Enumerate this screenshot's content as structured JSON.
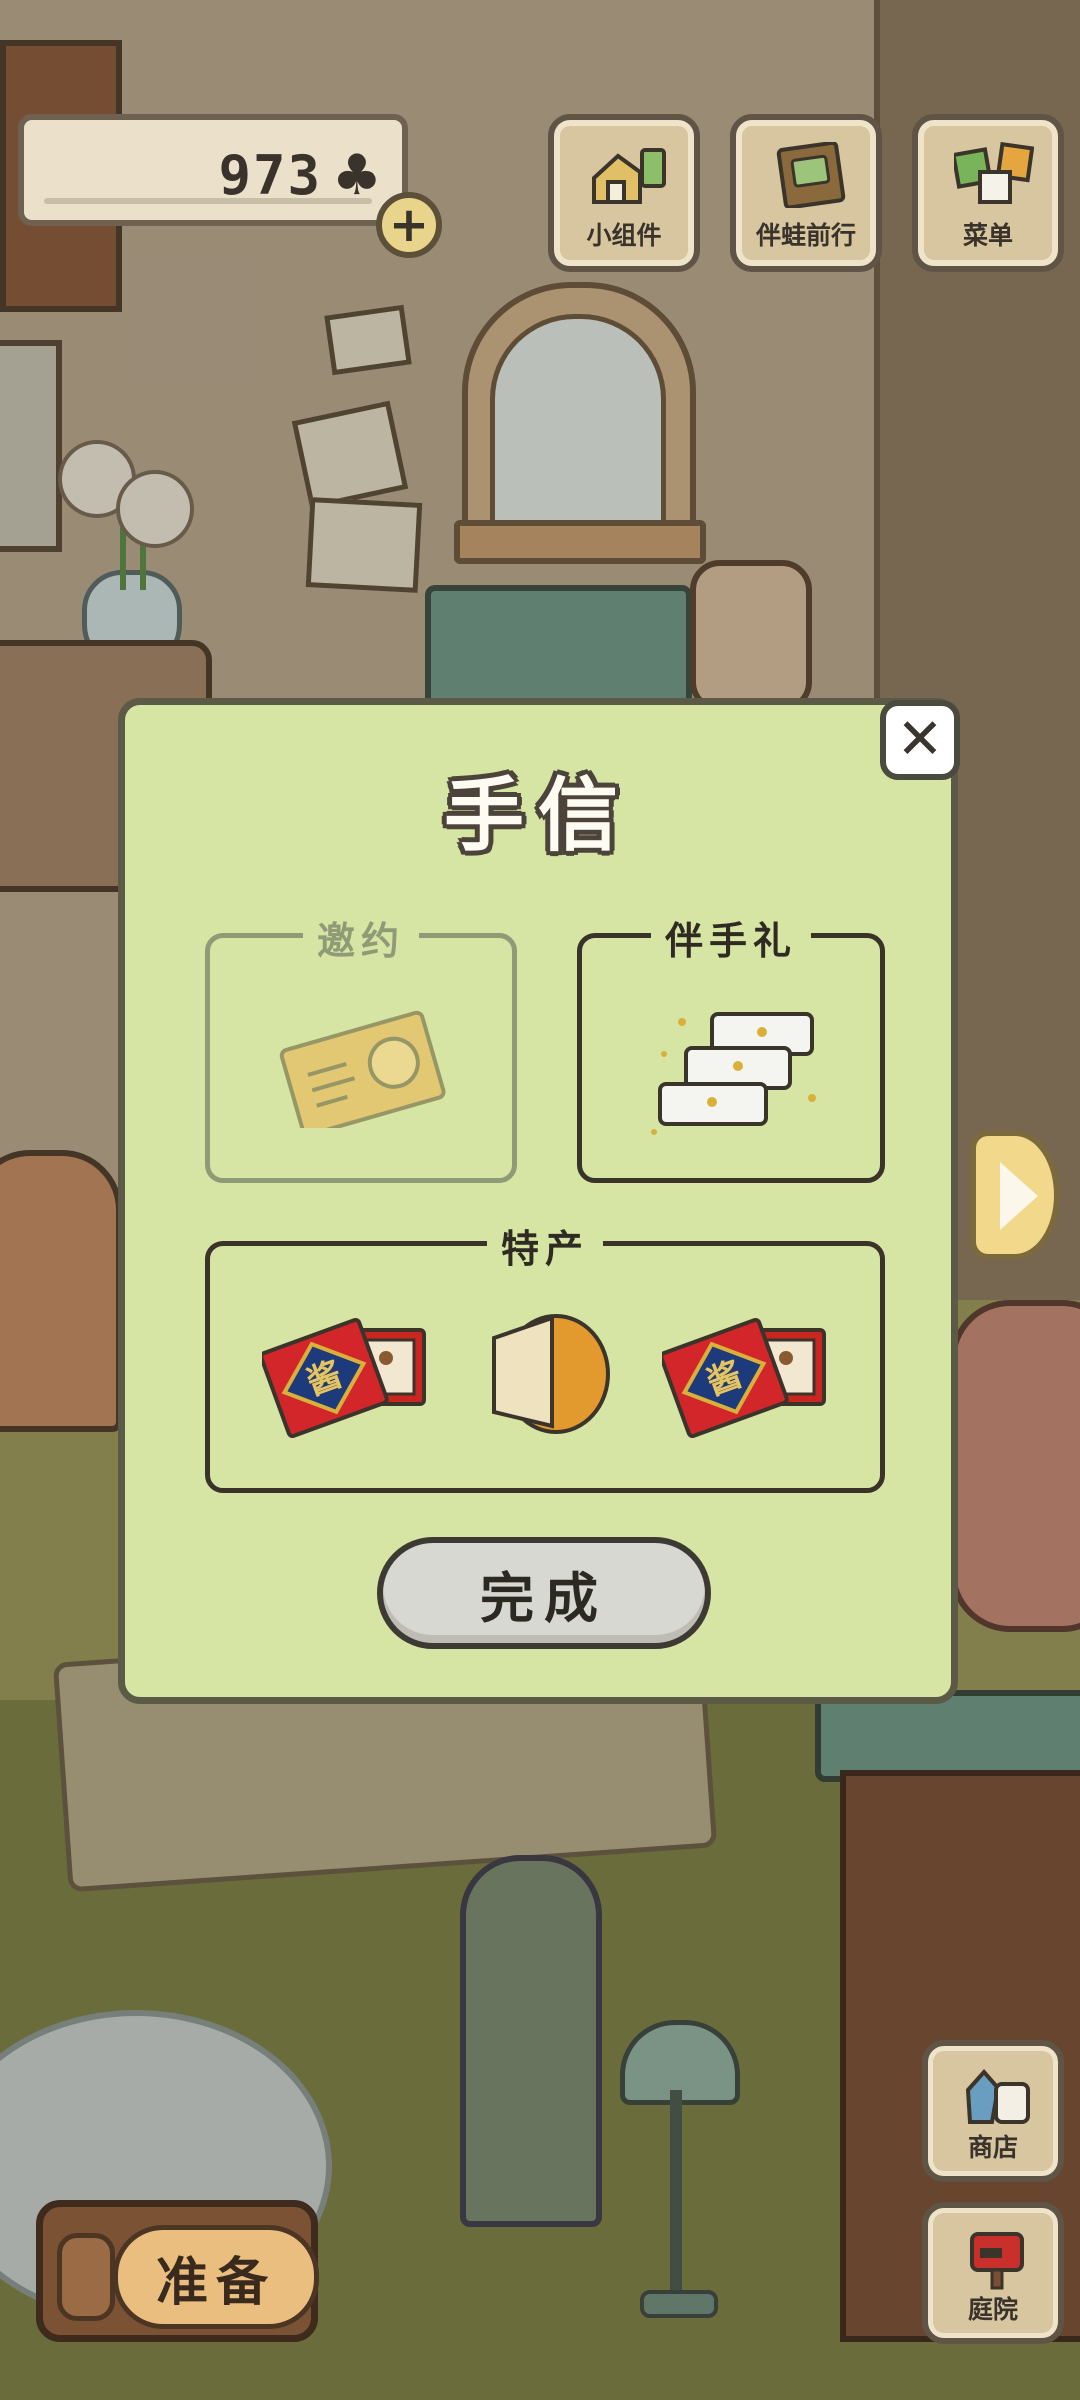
{
  "hud": {
    "clover_count": "973",
    "clover_symbol": "♣",
    "add_symbol": "+"
  },
  "top_buttons": [
    {
      "label": "小组件",
      "icon": "widget-icon"
    },
    {
      "label": "伴蛙前行",
      "icon": "journey-book-icon"
    },
    {
      "label": "菜单",
      "icon": "menu-cards-icon"
    }
  ],
  "dialog": {
    "title": "手信",
    "close_symbol": "✕",
    "sections": {
      "invitation": {
        "label": "邀约",
        "enabled": false
      },
      "gift": {
        "label": "伴手礼",
        "enabled": true
      },
      "specialty": {
        "label": "特产",
        "enabled": true
      }
    },
    "done_label": "完成"
  },
  "bottom": {
    "prepare_label": "准备",
    "shop_label": "商店",
    "yard_label": "庭院"
  },
  "colors": {
    "dialog_bg": "#d6e4a4",
    "dialog_border": "#5a5a46",
    "wood_button": "#d8c6a1",
    "tin_red": "#d2262a",
    "tin_blue": "#1d3b7a"
  }
}
